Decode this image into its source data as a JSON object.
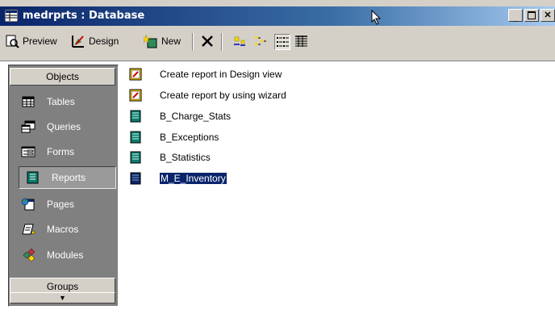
{
  "window": {
    "title": "medrprts : Database"
  },
  "toolbar": {
    "preview_label": "Preview",
    "design_label": "Design",
    "new_label": "New"
  },
  "sidebar": {
    "objects_label": "Objects",
    "groups_label": "Groups",
    "items": [
      {
        "label": "Tables",
        "icon": "table-icon"
      },
      {
        "label": "Queries",
        "icon": "query-icon"
      },
      {
        "label": "Forms",
        "icon": "form-icon"
      },
      {
        "label": "Reports",
        "icon": "report-icon",
        "selected": true
      },
      {
        "label": "Pages",
        "icon": "page-icon"
      },
      {
        "label": "Macros",
        "icon": "macro-icon"
      },
      {
        "label": "Modules",
        "icon": "module-icon"
      }
    ]
  },
  "list": {
    "items": [
      {
        "label": "Create report in Design view",
        "icon": "create-design-icon"
      },
      {
        "label": "Create report by using wizard",
        "icon": "create-wizard-icon"
      },
      {
        "label": "B_Charge_Stats",
        "icon": "report-icon"
      },
      {
        "label": "B_Exceptions",
        "icon": "report-icon"
      },
      {
        "label": "B_Statistics",
        "icon": "report-icon"
      },
      {
        "label": "M_E_Inventory",
        "icon": "report-icon",
        "selected": true
      }
    ]
  },
  "colors": {
    "titlebar_start": "#0a246a",
    "selection": "#0a246a",
    "sidebar_bg": "#808080"
  }
}
